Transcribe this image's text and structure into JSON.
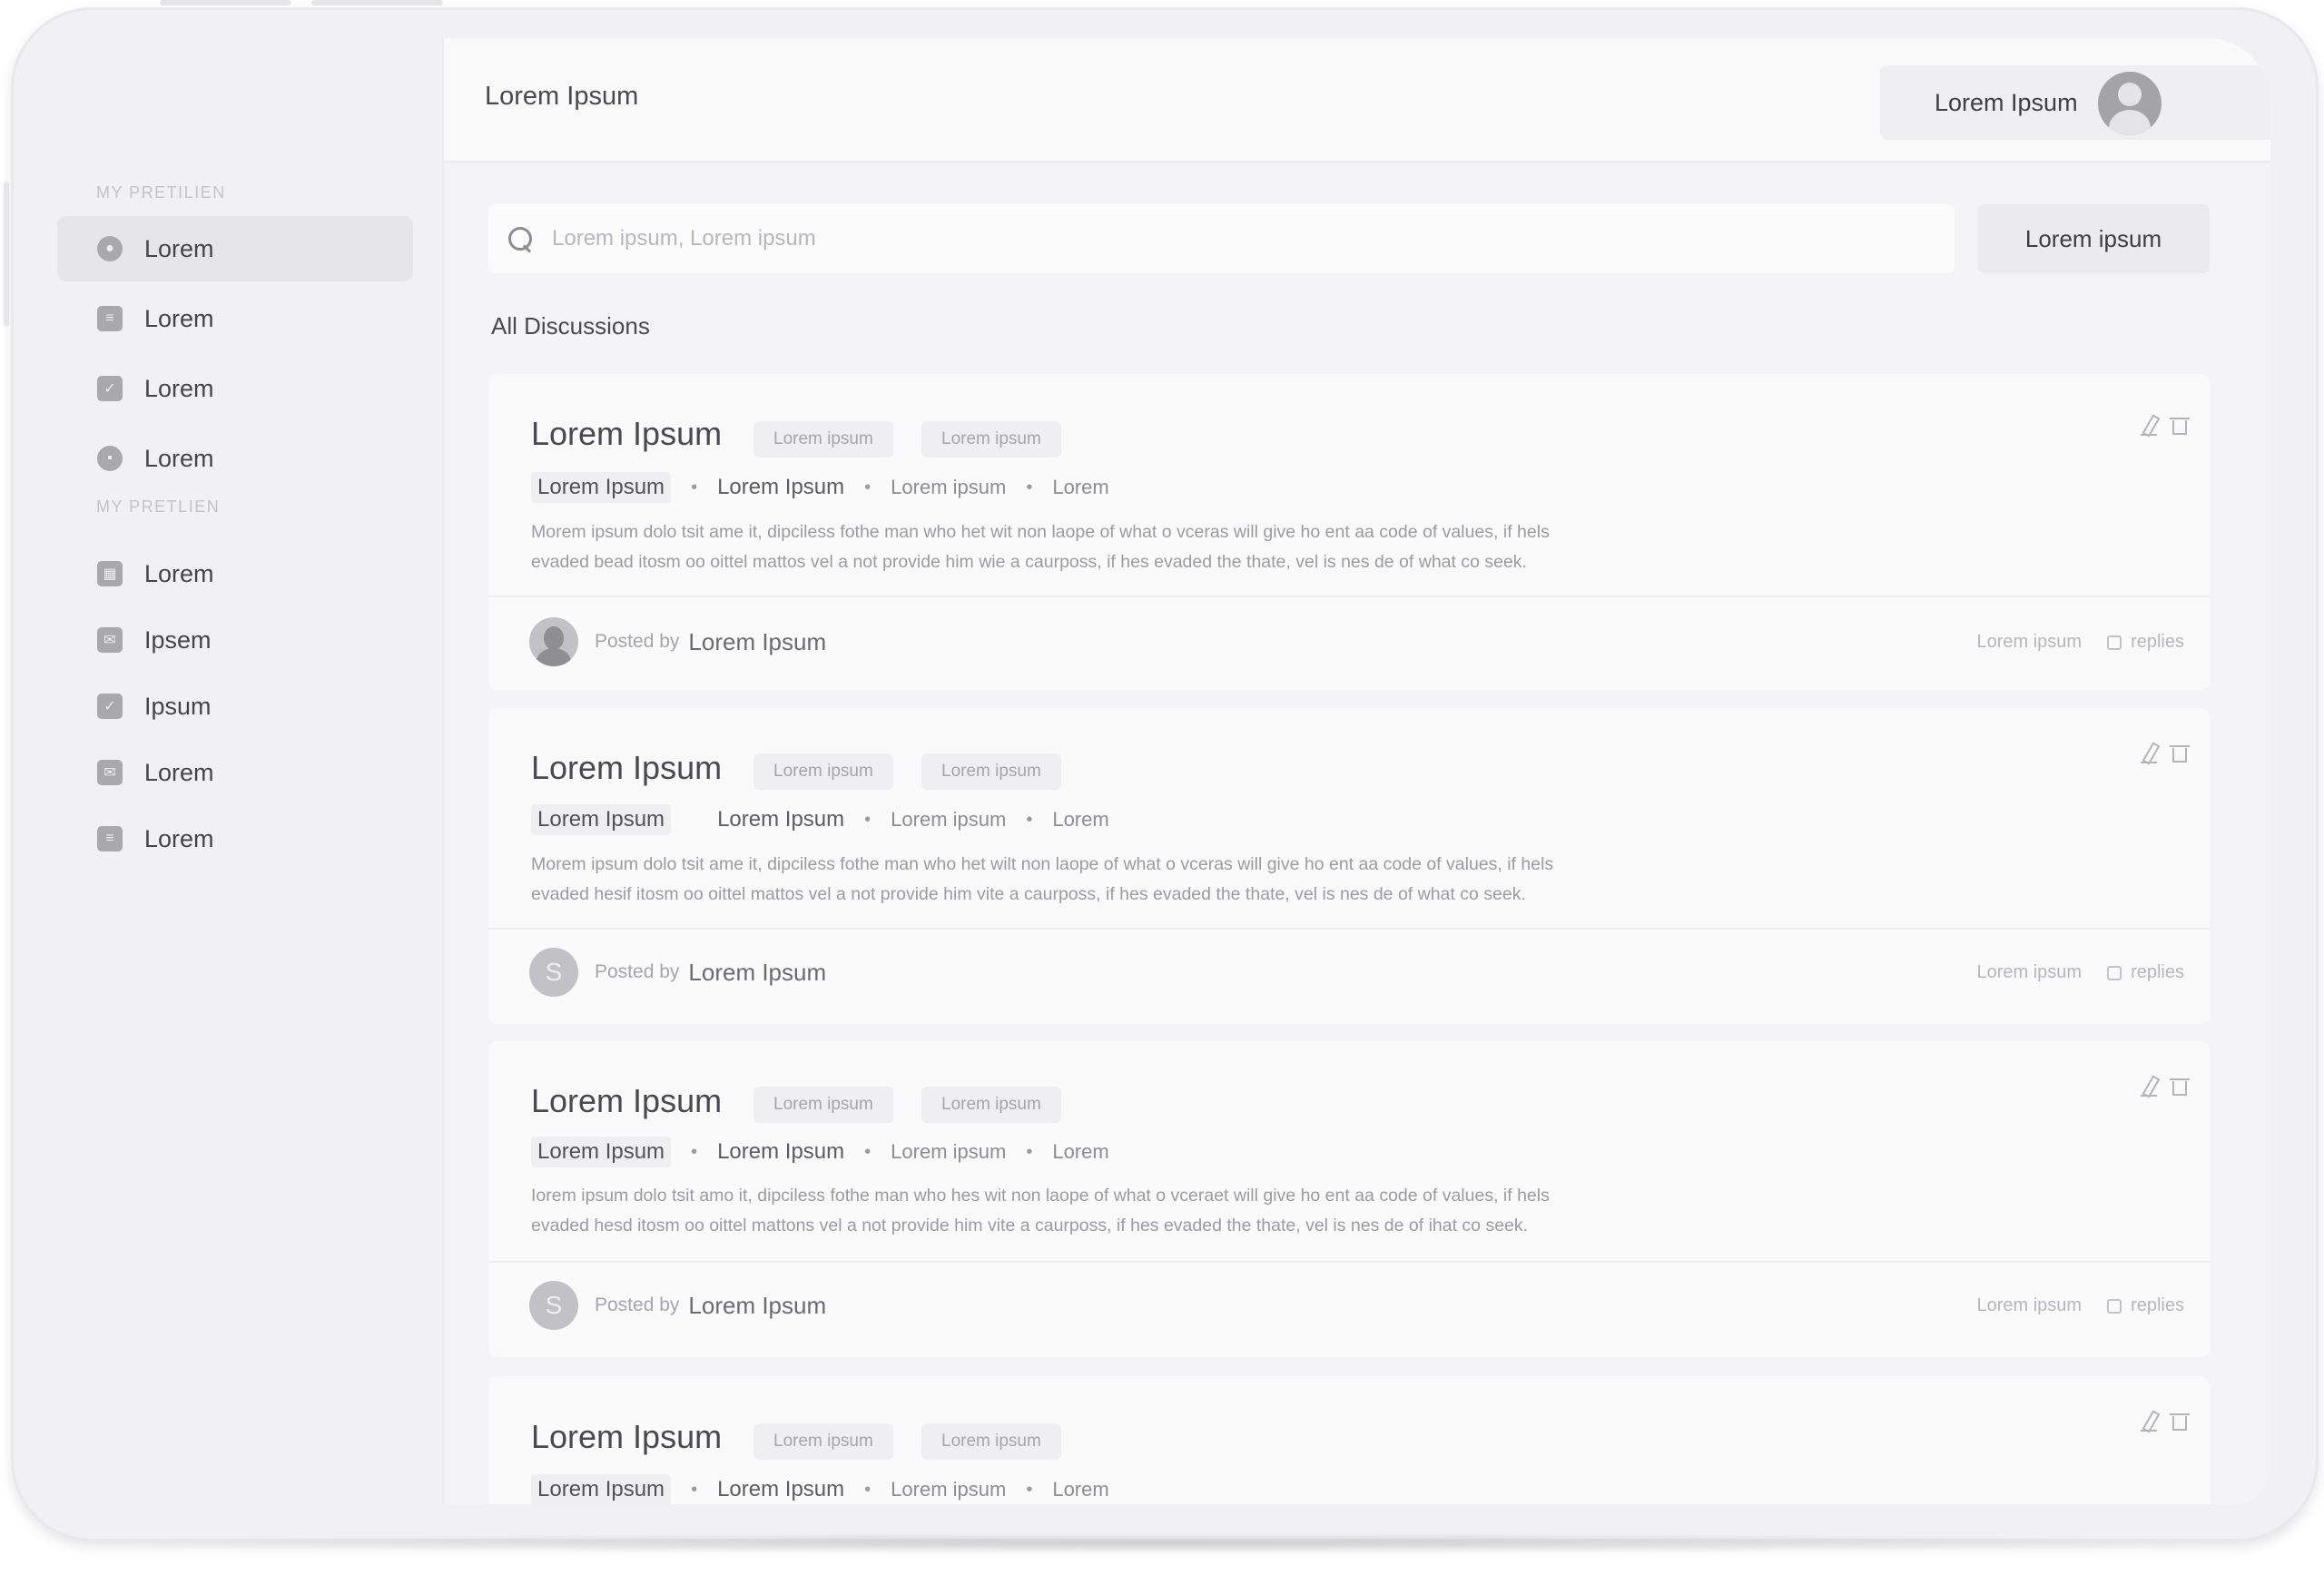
{
  "header": {
    "title": "Lorem Ipsum",
    "user_name": "Lorem Ipsum"
  },
  "sidebar": {
    "section1_heading": "MY PRETILIEN",
    "section2_heading": "MY PRETLIEN",
    "items1": [
      {
        "label": "Lorem",
        "icon": "clock-icon"
      },
      {
        "label": "Lorem",
        "icon": "document-icon"
      },
      {
        "label": "Lorem",
        "icon": "check-icon"
      },
      {
        "label": "Lorem",
        "icon": "chat-icon"
      }
    ],
    "items2": [
      {
        "label": "Lorem",
        "icon": "grid-icon"
      },
      {
        "label": "Ipsem",
        "icon": "mail-icon"
      },
      {
        "label": "Ipsum",
        "icon": "check-icon"
      },
      {
        "label": "Lorem",
        "icon": "mail-icon"
      },
      {
        "label": "Lorem",
        "icon": "document-icon"
      }
    ]
  },
  "search": {
    "placeholder": "Lorem ipsum, Lorem ipsum",
    "button_label": "Lorem ipsum"
  },
  "section_label": "All Discussions",
  "cards": [
    {
      "title": "Lorem Ipsum",
      "tags": [
        "Lorem ipsum",
        "Lorem ipsum"
      ],
      "meta": [
        "Lorem Ipsum",
        "Lorem Ipsum",
        "Lorem ipsum",
        "Lorem"
      ],
      "desc_line1": "Morem ipsum dolo tsit ame it, dipciless fothe man who het wit non laope of what o vceras will give ho ent aa code of values, if hels",
      "desc_line2": "evaded bead itosm oo oittel mattos vel a not provide him wie a caurposs, if hes evaded the thate, vel is nes de of what co seek.",
      "posted_by": "Posted by",
      "author": "Lorem Ipsum",
      "avatar": "person",
      "stat_label": "Lorem ipsum",
      "replies": "replies"
    },
    {
      "title": "Lorem Ipsum",
      "tags": [
        "Lorem ipsum",
        "Lorem ipsum"
      ],
      "meta": [
        "Lorem Ipsum",
        "Lorem Ipsum",
        "Lorem ipsum",
        "Lorem"
      ],
      "desc_line1": "Morem ipsum dolo tsit ame it, dipciless fothe man who het wilt non laope of what o vceras will give ho ent aa code of values, if hels",
      "desc_line2": "evaded hesif itosm oo oittel mattos vel a not provide him vite a caurposs, if hes evaded the thate, vel is nes de of what co seek.",
      "posted_by": "Posted by",
      "author": "Lorem Ipsum",
      "avatar": "S",
      "stat_label": "Lorem ipsum",
      "replies": "replies"
    },
    {
      "title": "Lorem Ipsum",
      "tags": [
        "Lorem ipsum",
        "Lorem ipsum"
      ],
      "meta": [
        "Lorem Ipsum",
        "Lorem Ipsum",
        "Lorem ipsum",
        "Lorem"
      ],
      "desc_line1": "Iorem ipsum dolo tsit amo it, dipciless fothe man who hes wit non laope of what o vceraet will give ho ent aa code of values, if hels",
      "desc_line2": "evaded hesd itosm oo oittel mattons vel a not provide him vite a caurposs, if hes evaded the thate, vel is nes de of ihat co seek.",
      "posted_by": "Posted by",
      "author": "Lorem Ipsum",
      "avatar": "S",
      "stat_label": "Lorem ipsum",
      "replies": "replies"
    },
    {
      "title": "Lorem Ipsum",
      "tags": [
        "Lorem ipsum",
        "Lorem ipsum"
      ],
      "meta": [
        "Lorem Ipsum",
        "Lorem Ipsum",
        "Lorem ipsum",
        "Lorem"
      ]
    }
  ]
}
